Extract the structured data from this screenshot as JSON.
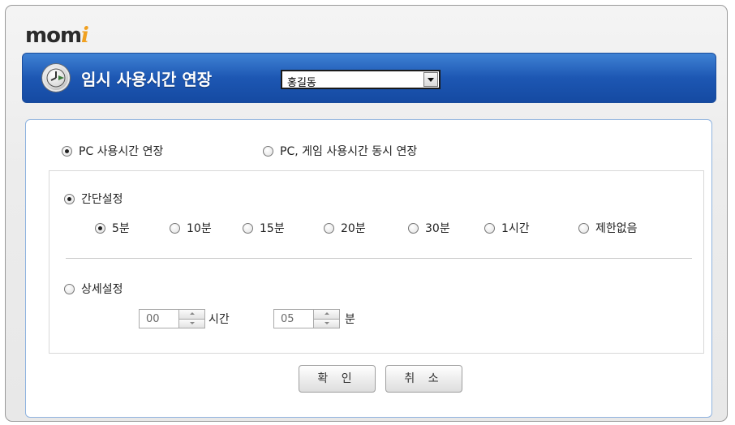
{
  "brand": {
    "text": "mom",
    "accent": "i"
  },
  "header": {
    "title": "임시 사용시간 연장",
    "user_select": "홍길동"
  },
  "mode": {
    "options": [
      {
        "label": "PC 사용시간 연장",
        "checked": true
      },
      {
        "label": "PC, 게임 사용시간 동시 연장",
        "checked": false
      }
    ]
  },
  "simple": {
    "label": "간단설정",
    "checked": true,
    "options": [
      {
        "label": "5분",
        "checked": true
      },
      {
        "label": "10분",
        "checked": false
      },
      {
        "label": "15분",
        "checked": false
      },
      {
        "label": "20분",
        "checked": false
      },
      {
        "label": "30분",
        "checked": false
      },
      {
        "label": "1시간",
        "checked": false
      },
      {
        "label": "제한없음",
        "checked": false
      }
    ]
  },
  "detail": {
    "label": "상세설정",
    "checked": false,
    "hours_value": "00",
    "hours_unit": "시간",
    "minutes_value": "05",
    "minutes_unit": "분"
  },
  "buttons": {
    "ok": "확 인",
    "cancel": "취 소"
  },
  "colors": {
    "header_blue": "#1d57b3",
    "panel_border": "#8fb3df",
    "brand_accent": "#f0a020"
  }
}
